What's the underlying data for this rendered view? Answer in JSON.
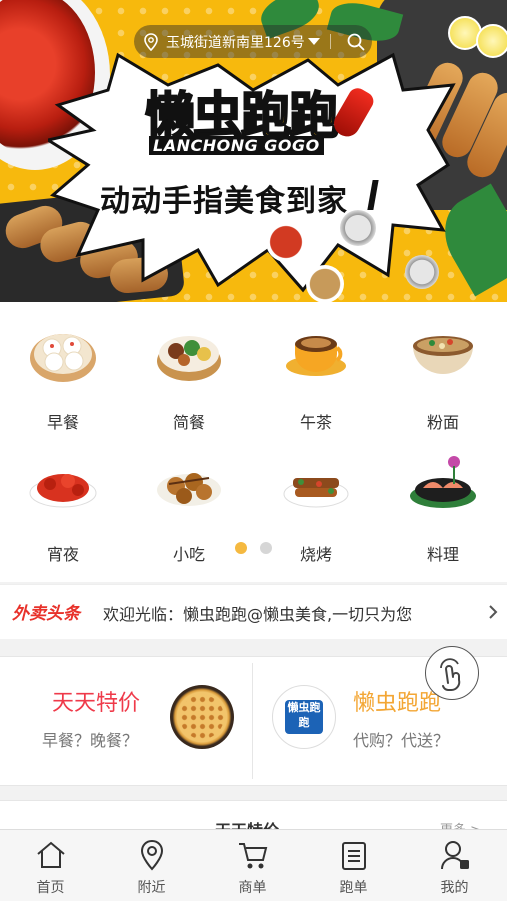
{
  "location": {
    "address": "玉城街道新南里126号"
  },
  "banner": {
    "logo_cn_1": "懒虫",
    "logo_cn_2": "跑跑",
    "logo_en": "LANCHONG GOGO",
    "slogan": "动动手指美食到家"
  },
  "categories": [
    {
      "label": "早餐",
      "icon": "steamed-buns-icon"
    },
    {
      "label": "简餐",
      "icon": "bento-box-icon"
    },
    {
      "label": "午茶",
      "icon": "tea-cup-icon"
    },
    {
      "label": "粉面",
      "icon": "noodle-bowl-icon"
    },
    {
      "label": "宵夜",
      "icon": "crayfish-plate-icon"
    },
    {
      "label": "小吃",
      "icon": "takoyaki-icon"
    },
    {
      "label": "烧烤",
      "icon": "bbq-skewer-icon"
    },
    {
      "label": "料理",
      "icon": "sashimi-platter-icon"
    }
  ],
  "pager": {
    "pages": 2,
    "active": 1
  },
  "news": {
    "tag": "外卖头条",
    "message": "欢迎光临：懒虫跑跑@懒虫美食,一切只为您"
  },
  "promos": [
    {
      "title": "天天特价",
      "subtitle": "早餐？晚餐？"
    },
    {
      "title": "懒虫跑跑",
      "subtitle": "代购？代送？",
      "logo_text": "懒虫跑跑"
    }
  ],
  "section": {
    "title": "天天特价",
    "more": "更多 >"
  },
  "tabs": [
    {
      "label": "首页",
      "icon": "home-icon"
    },
    {
      "label": "附近",
      "icon": "location-pin-icon"
    },
    {
      "label": "商单",
      "icon": "shopping-cart-icon"
    },
    {
      "label": "跑单",
      "icon": "clipboard-list-icon"
    },
    {
      "label": "我的",
      "icon": "user-profile-icon"
    }
  ],
  "colors": {
    "banner_yellow": "#f7b90d",
    "news_red": "#e8322b",
    "promo_red": "#ef3a4a",
    "promo_orange": "#f3a634",
    "pager_active": "#f5b940",
    "pager_inactive": "#d6d6d6"
  }
}
